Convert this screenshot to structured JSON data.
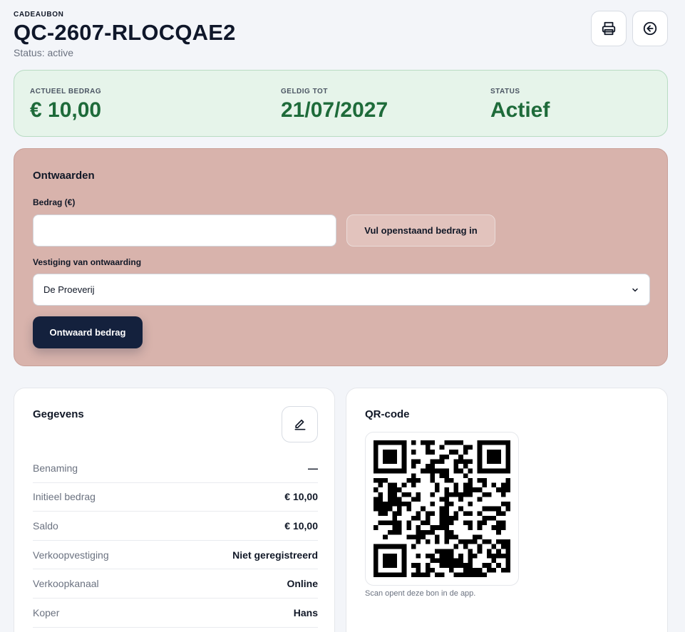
{
  "header": {
    "eyebrow": "CADEAUBON",
    "code": "QC-2607-RLOCQAE2",
    "status_line": "Status: active"
  },
  "summary": {
    "amount_label": "ACTUEEL BEDRAG",
    "amount_value": "€ 10,00",
    "valid_label": "GELDIG TOT",
    "valid_value": "21/07/2027",
    "status_label": "STATUS",
    "status_value": "Actief"
  },
  "redeem": {
    "title": "Ontwaarden",
    "amount_label": "Bedrag (€)",
    "amount_value": "",
    "fill_button": "Vul openstaand bedrag in",
    "location_label": "Vestiging van ontwaarding",
    "location_selected": "De Proeverij",
    "submit_button": "Ontwaard bedrag"
  },
  "details": {
    "title": "Gegevens",
    "rows": [
      {
        "key": "Benaming",
        "value": "—"
      },
      {
        "key": "Initieel bedrag",
        "value": "€ 10,00"
      },
      {
        "key": "Saldo",
        "value": "€ 10,00"
      },
      {
        "key": "Verkoopvestiging",
        "value": "Niet geregistreerd"
      },
      {
        "key": "Verkoopkanaal",
        "value": "Online"
      },
      {
        "key": "Koper",
        "value": "Hans"
      }
    ]
  },
  "qr": {
    "title": "QR-code",
    "caption": "Scan opent deze bon in de app."
  },
  "colors": {
    "summary_bg": "#e6f4ea",
    "summary_accent": "#1e6b3a",
    "redeem_bg": "#d8b3ac",
    "primary_button": "#14213d"
  },
  "icons": [
    "printer-icon",
    "arrow-left-circle-icon",
    "pencil-icon",
    "chevron-down-icon",
    "qr-code-icon"
  ]
}
